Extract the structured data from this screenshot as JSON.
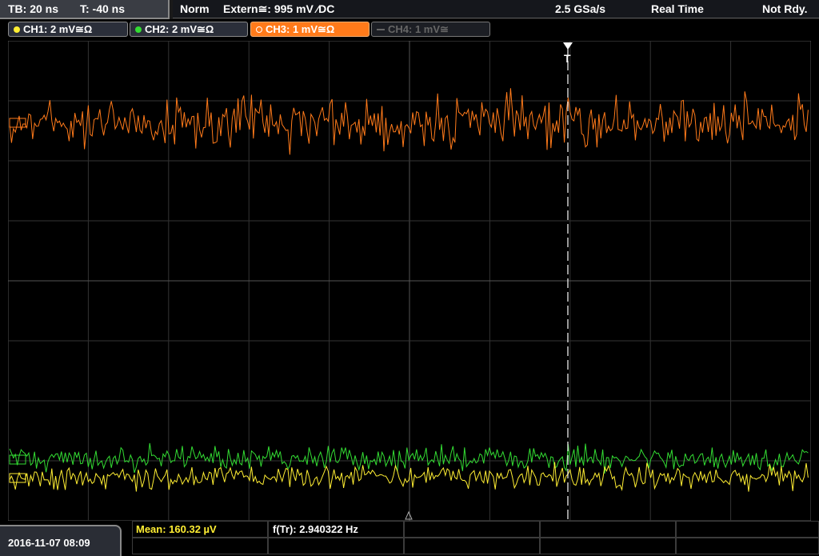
{
  "timebase": {
    "tb": "TB: 20 ns",
    "t": "T: -40 ns"
  },
  "status": {
    "mode": "Norm",
    "trigger": "Extern≅: 995 mV ⁄DC",
    "sample_rate": "2.5 GSa/s",
    "acq": "Real Time",
    "state": "Not Rdy."
  },
  "channels": [
    {
      "label": "CH1: 2 mV≅Ω",
      "color": "#ffee33",
      "active": true
    },
    {
      "label": "CH2: 2 mV≅Ω",
      "color": "#33dd33",
      "active": true
    },
    {
      "label": "CH3: 1 mV≅Ω",
      "color": "#ff7a1a",
      "active": true,
      "selected": true
    },
    {
      "label": "CH4: 1 mV≅",
      "color": "#777777",
      "active": false
    }
  ],
  "trigger_marker": "T",
  "measurements": {
    "mean": "Mean: 160.32 µV",
    "freq": "f(Tr): 2.940322 Hz"
  },
  "datetime": "2016-11-07 08:09",
  "colors": {
    "ch1": "#ffee33",
    "ch2": "#33dd33",
    "ch3": "#ff7a1a",
    "grid": "#3a3a3a",
    "trigger_line": "#ffffff"
  },
  "icons": {
    "channel_dot": "circle",
    "trigger_arrow": "down-triangle",
    "ground_marker": "triangle"
  }
}
